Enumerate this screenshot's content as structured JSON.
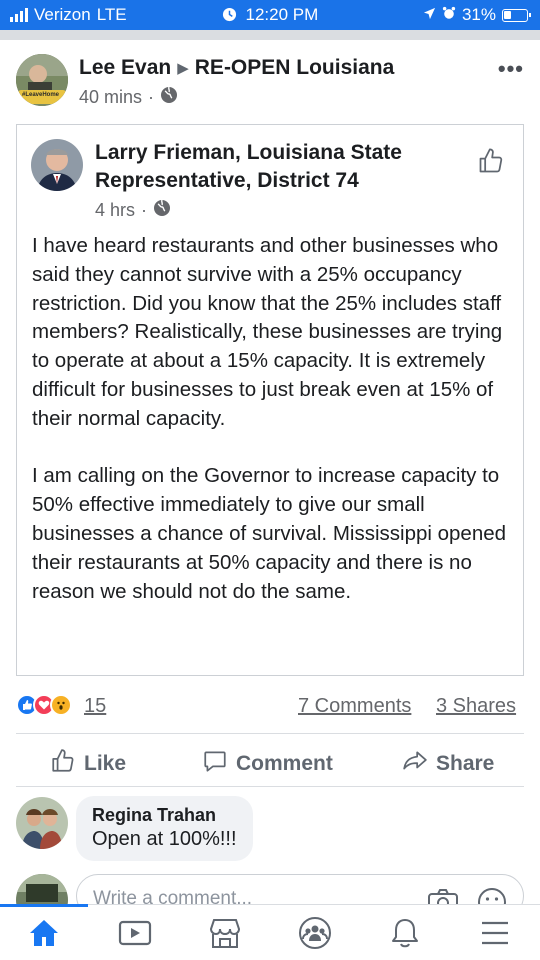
{
  "status_bar": {
    "carrier": "Verizon",
    "network": "LTE",
    "time": "12:20 PM",
    "battery": "31%"
  },
  "post": {
    "author": "Lee Evan",
    "group": "RE-OPEN Louisiana",
    "time": "40 mins",
    "avatar_badge": "#LeaveHome"
  },
  "shared_post": {
    "author": "Larry Frieman, Louisiana State Representative, District 74",
    "time": "4 hrs",
    "paragraphs": [
      "I have heard restaurants and other businesses who said they cannot survive with a 25% occupancy restriction.  Did you know that the 25% includes staff members?  Realistically, these businesses are trying to operate at about a 15% capacity.  It is extremely difficult for businesses to just break even at 15% of their normal capacity.",
      "I am calling on the Governor to increase capacity to 50% effective immediately to give our small businesses a chance of survival. Mississippi opened their restaurants at 50% capacity and there is no reason we should not do the same."
    ]
  },
  "engagement": {
    "reaction_count": "15",
    "comments": "7 Comments",
    "shares": "3 Shares"
  },
  "actions": {
    "like": "Like",
    "comment": "Comment",
    "share": "Share"
  },
  "comment": {
    "name": "Regina Trahan",
    "text": "Open at 100%!!!"
  },
  "composer": {
    "placeholder": "Write a comment..."
  },
  "colors": {
    "brand_blue": "#1877f2",
    "status_bar_blue": "#1a73e8",
    "love_red": "#f33e58",
    "wow_yellow": "#f7b125"
  },
  "icons": [
    "signal-icon",
    "alarm-icon",
    "location-icon",
    "battery-icon",
    "globe-icon",
    "like-icon",
    "comment-icon",
    "share-icon",
    "camera-icon",
    "emoji-icon",
    "home-icon",
    "video-icon",
    "marketplace-icon",
    "groups-icon",
    "bell-icon",
    "menu-icon"
  ]
}
